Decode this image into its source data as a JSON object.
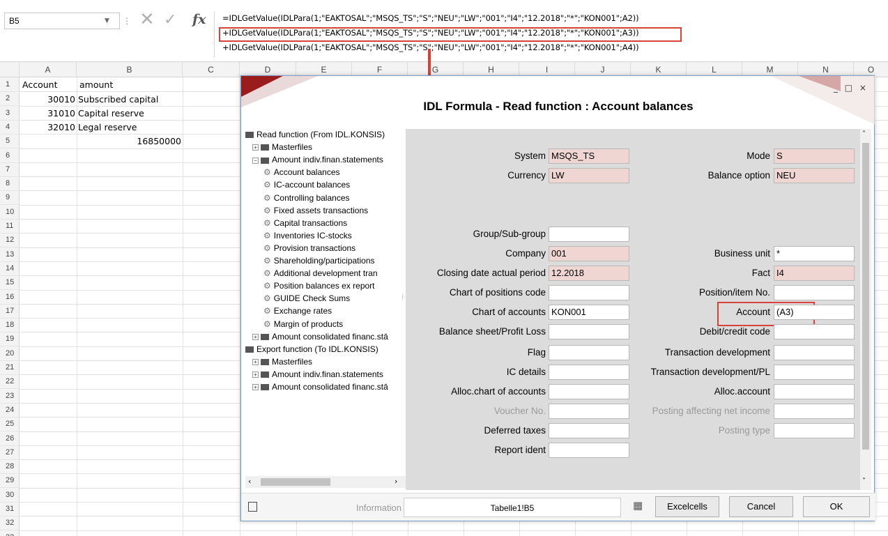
{
  "formula_bar": {
    "namebox": "B5",
    "fx": "fx",
    "lines": [
      "=IDLGetValue(IDLPara(1;\"EAKTOSAL\";\"MSQS_TS\";\"S\";\"NEU\";\"LW\";\"001\";\"I4\";\"12.2018\";\"*\";\"KON001\";A2))",
      "+IDLGetValue(IDLPara(1;\"EAKTOSAL\";\"MSQS_TS\";\"S\";\"NEU\";\"LW\";\"001\";\"I4\";\"12.2018\";\"*\";\"KON001\";A3))",
      "+IDLGetValue(IDLPara(1;\"EAKTOSAL\";\"MSQS_TS\";\"S\";\"NEU\";\"LW\";\"001\";\"I4\";\"12.2018\";\"*\";\"KON001\";A4))"
    ]
  },
  "sheet": {
    "columns": [
      "A",
      "B",
      "C",
      "D",
      "E",
      "F",
      "G",
      "H",
      "I",
      "J",
      "K",
      "L",
      "M",
      "N",
      "O"
    ],
    "rows": [
      "1",
      "2",
      "3",
      "4",
      "5",
      "6",
      "7",
      "8",
      "9",
      "10",
      "11",
      "12",
      "13",
      "14",
      "15",
      "16",
      "17",
      "18",
      "19",
      "20",
      "21",
      "22",
      "23",
      "24",
      "25",
      "26",
      "27",
      "28",
      "29",
      "30",
      "31",
      "32",
      "33"
    ],
    "cells": {
      "A1": "Account",
      "B1": "amount",
      "A2": "30010",
      "B2": "Subscribed capital",
      "A3": "31010",
      "B3": "Capital reserve",
      "A4": "32010",
      "B4": "Legal reserve",
      "B5": "16850000"
    }
  },
  "dialog": {
    "title": "IDL Formula - Read function : Account balances",
    "window_controls": "_ □ ×",
    "tree": [
      {
        "label": "Read function (From IDL.KONSIS)",
        "type": "folder"
      },
      {
        "label": "Masterfiles",
        "type": "collapsed"
      },
      {
        "label": "Amount indiv.finan.statements",
        "type": "expanded"
      },
      {
        "label": "Account balances",
        "type": "item"
      },
      {
        "label": "IC-account balances",
        "type": "item"
      },
      {
        "label": "Controlling balances",
        "type": "item"
      },
      {
        "label": "Fixed assets transactions",
        "type": "item"
      },
      {
        "label": "Capital transactions",
        "type": "item"
      },
      {
        "label": "Inventories IC-stocks",
        "type": "item"
      },
      {
        "label": "Provision transactions",
        "type": "item"
      },
      {
        "label": "Shareholding/participations",
        "type": "item"
      },
      {
        "label": "Additional development tran",
        "type": "item"
      },
      {
        "label": "Position balances ex report",
        "type": "item"
      },
      {
        "label": "GUIDE Check Sums",
        "type": "item"
      },
      {
        "label": "Exchange rates",
        "type": "item"
      },
      {
        "label": "Margin of products",
        "type": "item"
      },
      {
        "label": "Amount consolidated financ.stā",
        "type": "collapsed"
      },
      {
        "label": "Export function (To IDL.KONSIS)",
        "type": "folder"
      },
      {
        "label": "Masterfiles",
        "type": "collapsed"
      },
      {
        "label": "Amount indiv.finan.statements",
        "type": "collapsed"
      },
      {
        "label": "Amount consolidated financ.stā",
        "type": "collapsed"
      }
    ],
    "left_fields": {
      "system": {
        "label": "System",
        "value": "MSQS_TS"
      },
      "currency": {
        "label": "Currency",
        "value": "LW"
      },
      "group": {
        "label": "Group/Sub-group",
        "value": ""
      },
      "company": {
        "label": "Company",
        "value": "001"
      },
      "closing": {
        "label": "Closing date actual period",
        "value": "12.2018"
      },
      "chart_pos": {
        "label": "Chart of positions code",
        "value": ""
      },
      "chart_acc": {
        "label": "Chart of accounts",
        "value": "KON001"
      },
      "bs_pl": {
        "label": "Balance sheet/Profit  Loss",
        "value": ""
      },
      "flag": {
        "label": "Flag",
        "value": ""
      },
      "ic": {
        "label": "IC details",
        "value": ""
      },
      "alloc_chart": {
        "label": "Alloc.chart of accounts",
        "value": ""
      },
      "voucher": {
        "label": "Voucher No.",
        "value": ""
      },
      "deferred": {
        "label": "Deferred taxes",
        "value": ""
      },
      "report": {
        "label": "Report ident",
        "value": ""
      }
    },
    "right_fields": {
      "mode": {
        "label": "Mode",
        "value": "S"
      },
      "balance": {
        "label": "Balance option",
        "value": "NEU"
      },
      "bu": {
        "label": "Business unit",
        "value": "*"
      },
      "fact": {
        "label": "Fact",
        "value": "I4"
      },
      "posno": {
        "label": "Position/item No.",
        "value": ""
      },
      "account": {
        "label": "Account",
        "value": "(A3)"
      },
      "debit": {
        "label": "Debit/credit code",
        "value": ""
      },
      "tdev": {
        "label": "Transaction development",
        "value": ""
      },
      "tdevpl": {
        "label": "Transaction development/PL",
        "value": ""
      },
      "alloc_acc": {
        "label": "Alloc.account",
        "value": ""
      },
      "posting_net": {
        "label": "Posting affecting net income",
        "value": ""
      },
      "posting_type": {
        "label": "Posting type",
        "value": ""
      }
    },
    "bottom": {
      "info_label": "Information",
      "info_value": "Tabelle1!B5",
      "excelcells": "Excelcells",
      "cancel": "Cancel",
      "ok": "OK"
    }
  }
}
